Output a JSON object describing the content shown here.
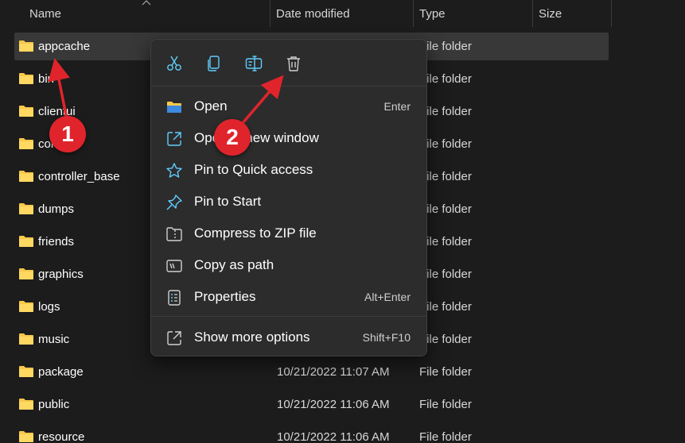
{
  "columns": {
    "name": "Name",
    "date_modified": "Date modified",
    "type": "Type",
    "size": "Size"
  },
  "rows": [
    {
      "name": "appcache",
      "date": "",
      "type": "File folder",
      "selected": true
    },
    {
      "name": "bin",
      "date": "",
      "type": "File folder"
    },
    {
      "name": "clientui",
      "date": "",
      "type": "File folder"
    },
    {
      "name": "config",
      "date": "",
      "type": "File folder"
    },
    {
      "name": "controller_base",
      "date": "",
      "type": "File folder"
    },
    {
      "name": "dumps",
      "date": "",
      "type": "File folder"
    },
    {
      "name": "friends",
      "date": "",
      "type": "File folder"
    },
    {
      "name": "graphics",
      "date": "",
      "type": "File folder"
    },
    {
      "name": "logs",
      "date": "",
      "type": "File folder"
    },
    {
      "name": "music",
      "date": "",
      "type": "File folder"
    },
    {
      "name": "package",
      "date": "10/21/2022 11:07 AM",
      "type": "File folder"
    },
    {
      "name": "public",
      "date": "10/21/2022 11:06 AM",
      "type": "File folder"
    },
    {
      "name": "resource",
      "date": "10/21/2022 11:06 AM",
      "type": "File folder"
    }
  ],
  "context_menu": {
    "toolbar": [
      "cut-icon",
      "copy-icon",
      "rename-icon",
      "delete-icon"
    ],
    "items": [
      {
        "label": "Open",
        "shortcut": "Enter",
        "icon": "folder-open-icon"
      },
      {
        "label": "Open in new window",
        "shortcut": "",
        "icon": "open-external-icon"
      },
      {
        "label": "Pin to Quick access",
        "shortcut": "",
        "icon": "star-icon"
      },
      {
        "label": "Pin to Start",
        "shortcut": "",
        "icon": "pin-icon"
      },
      {
        "label": "Compress to ZIP file",
        "shortcut": "",
        "icon": "zip-folder-icon"
      },
      {
        "label": "Copy as path",
        "shortcut": "",
        "icon": "copy-path-icon"
      },
      {
        "label": "Properties",
        "shortcut": "Alt+Enter",
        "icon": "properties-icon"
      },
      {
        "label": "Show more options",
        "shortcut": "Shift+F10",
        "icon": "more-options-icon"
      }
    ]
  },
  "annotations": {
    "step1": "1",
    "step2": "2"
  },
  "colors": {
    "accent": "#60cdff",
    "folder": "#f8c84a",
    "badge": "#e0242c"
  }
}
